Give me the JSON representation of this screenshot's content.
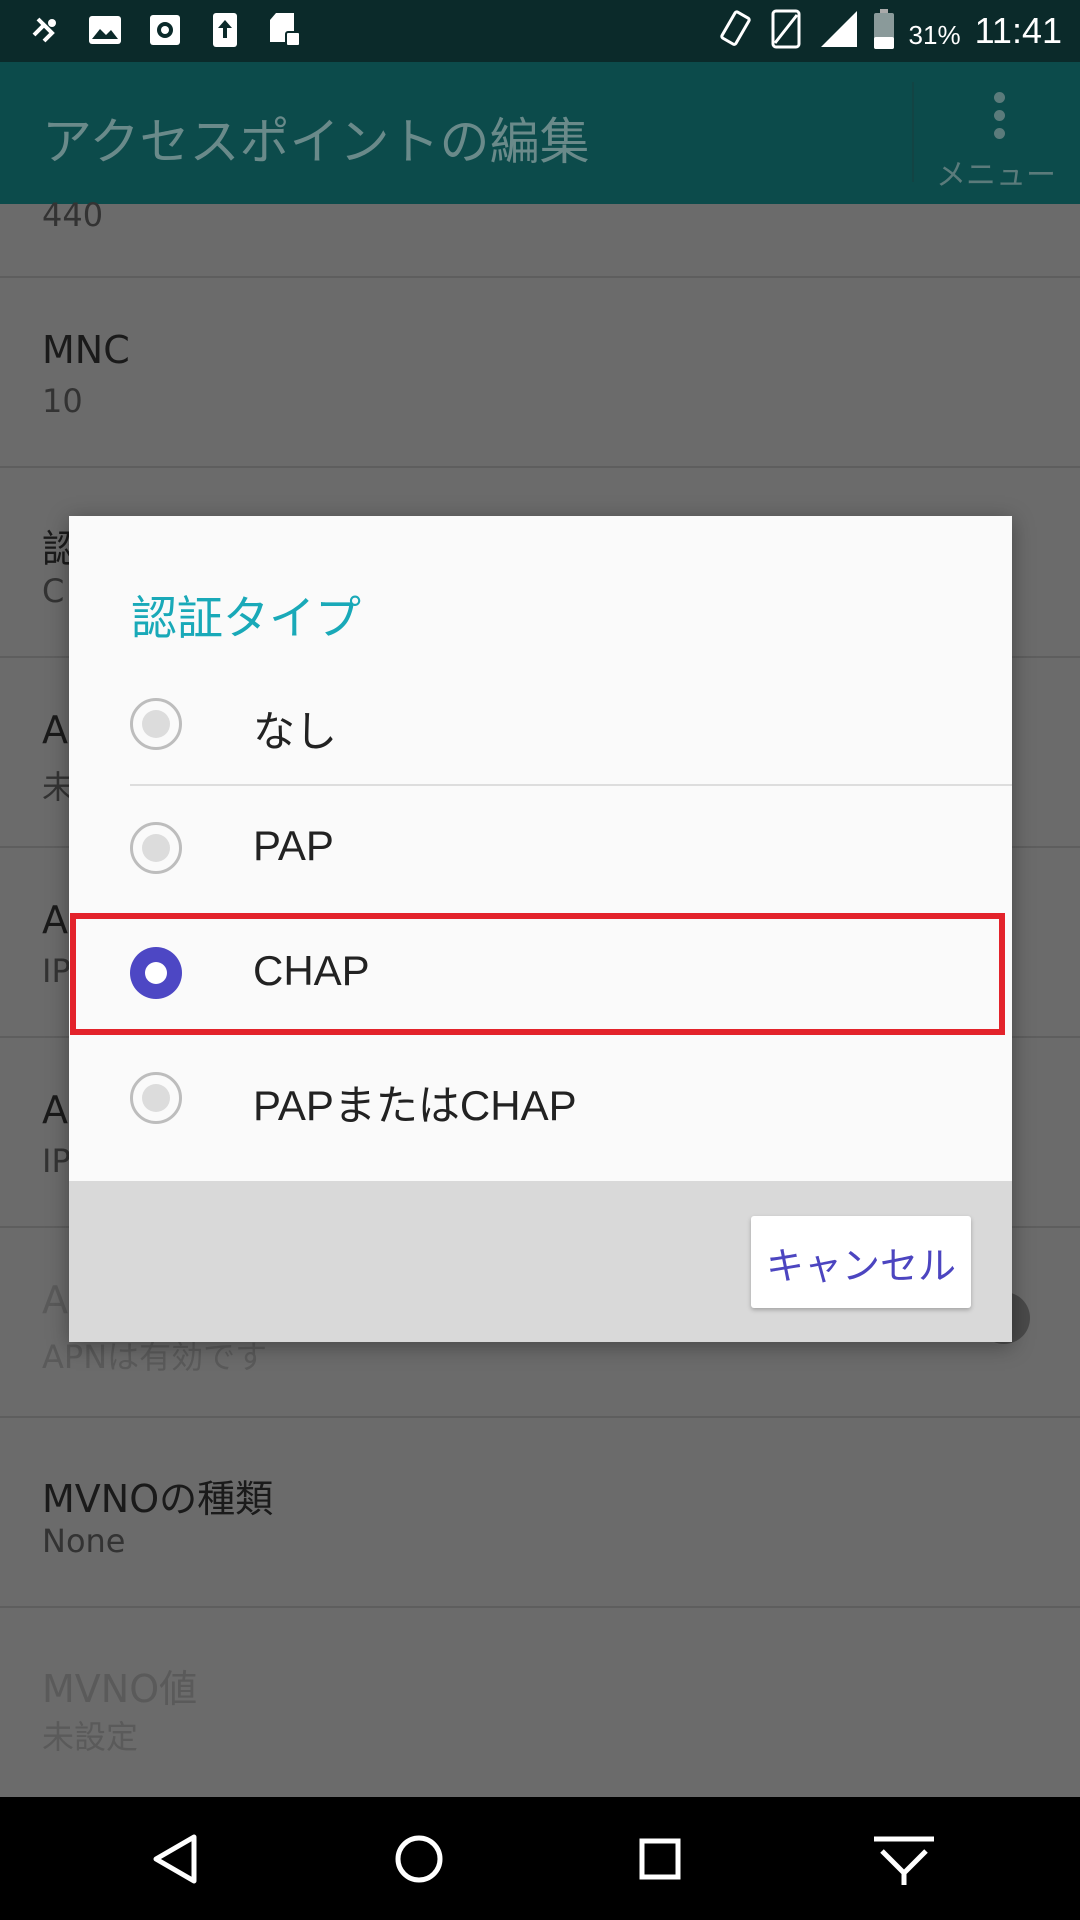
{
  "status_bar": {
    "battery_percent": "31%",
    "time": "11:41",
    "left_icons": [
      "usb-debug-icon",
      "image-icon",
      "settings-app-icon",
      "upload-icon",
      "sd-card-icon"
    ],
    "right_icons": [
      "vibrate-icon",
      "no-sim-icon",
      "signal-icon",
      "battery-icon"
    ]
  },
  "app_bar": {
    "title": "アクセスポイントの編集",
    "menu_label": "メニュー"
  },
  "settings_list": {
    "partial_top_value": "440",
    "items": [
      {
        "title": "MNC",
        "value": "10"
      },
      {
        "title": "認",
        "value": "C"
      },
      {
        "title": "A",
        "value": "未"
      },
      {
        "title": "A",
        "value": "IP"
      },
      {
        "title": "A",
        "value": "IP"
      },
      {
        "title": "A",
        "value": "APNは有効です"
      },
      {
        "title": "MVNOの種類",
        "value": "None"
      },
      {
        "title": "MVNO値",
        "value": "未設定"
      }
    ]
  },
  "dialog": {
    "title": "認証タイプ",
    "options": [
      {
        "label": "なし",
        "selected": false
      },
      {
        "label": "PAP",
        "selected": false
      },
      {
        "label": "CHAP",
        "selected": true
      },
      {
        "label": "PAPまたはCHAP",
        "selected": false
      }
    ],
    "cancel_label": "キャンセル",
    "highlight_color": "#e3232b",
    "accent_color": "#19a9b8",
    "radio_selected_color": "#4d47c4"
  },
  "nav_bar": {
    "buttons": [
      "back-icon",
      "home-icon",
      "recents-icon",
      "hide-nav-icon"
    ]
  }
}
